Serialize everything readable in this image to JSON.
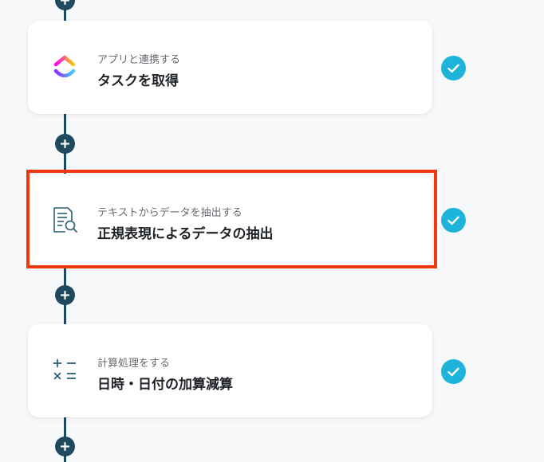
{
  "steps": [
    {
      "subtitle": "アプリと連携する",
      "title": "タスクを取得",
      "icon": "clickup-logo-icon",
      "status": "completed",
      "highlighted": false
    },
    {
      "subtitle": "テキストからデータを抽出する",
      "title": "正規表現によるデータの抽出",
      "icon": "document-search-icon",
      "status": "completed",
      "highlighted": true
    },
    {
      "subtitle": "計算処理をする",
      "title": "日時・日付の加算減算",
      "icon": "calculator-operators-icon",
      "status": "completed",
      "highlighted": false
    }
  ],
  "colors": {
    "line": "#1e4a5f",
    "check": "#1eb3da",
    "highlight_border": "#ec3a0c",
    "title": "#1f2328",
    "subtitle": "#666b70"
  }
}
